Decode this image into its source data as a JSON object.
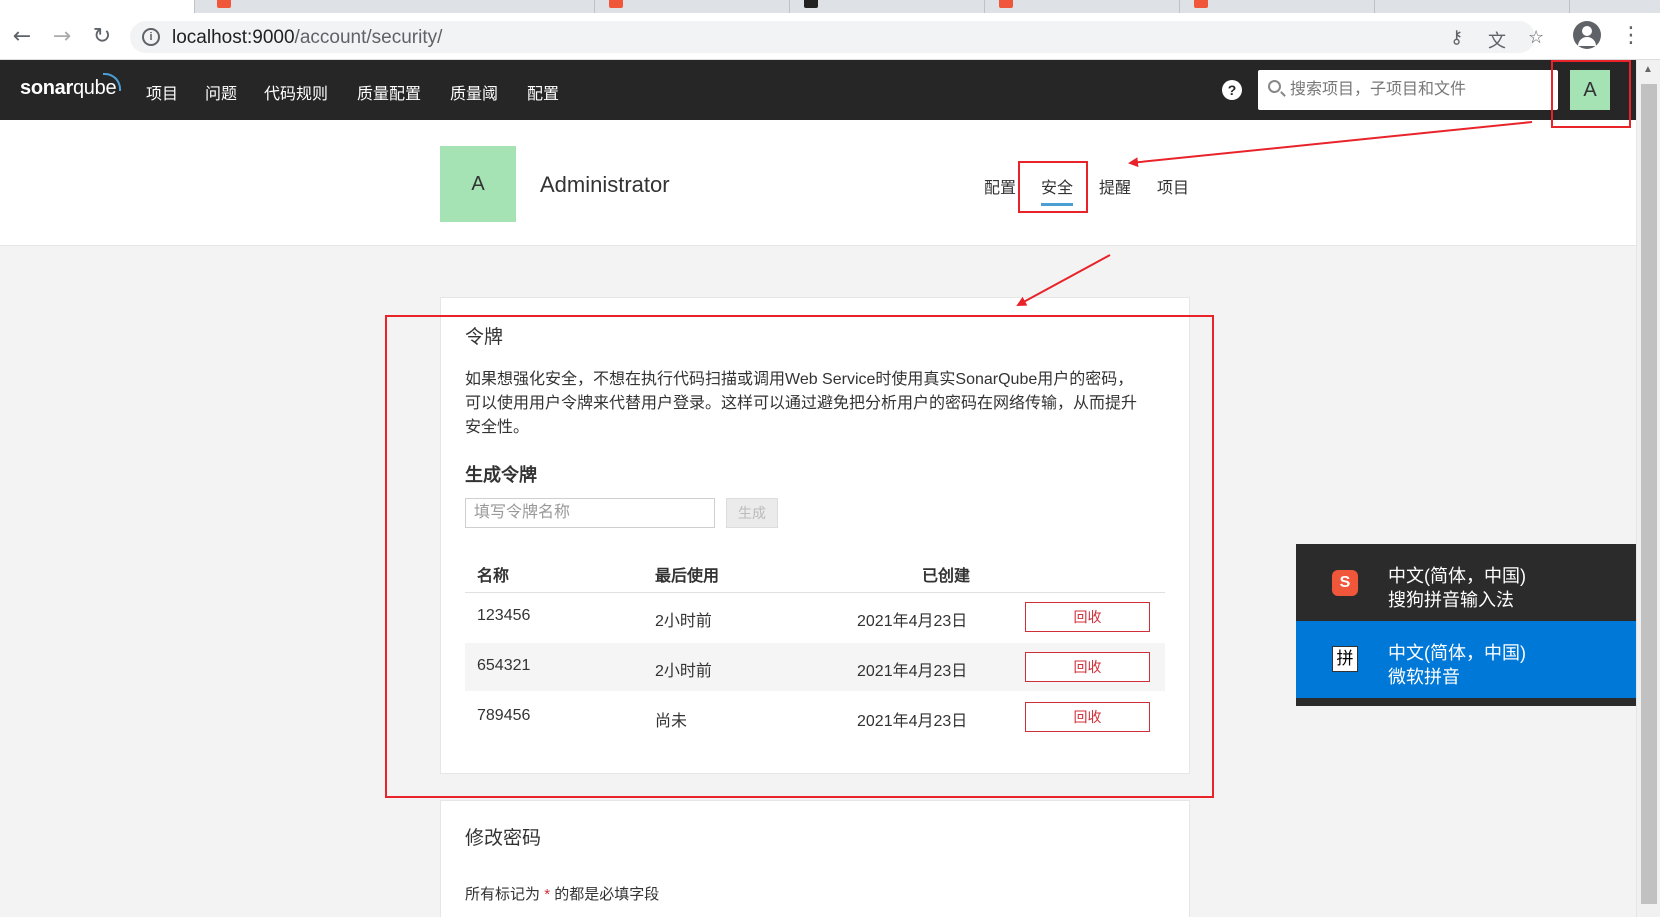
{
  "browser": {
    "url_host": "localhost:9000",
    "url_path": "/account/security/",
    "key_icon": "key-icon",
    "translate_icon": "translate-icon",
    "star_icon": "star-icon"
  },
  "nav": {
    "logo_sonar": "sonar",
    "logo_qube": "qube",
    "items": [
      "项目",
      "问题",
      "代码规则",
      "质量配置",
      "质量阈",
      "配置"
    ],
    "help": "?",
    "search_placeholder": "搜索项目，子项目和文件",
    "avatar_letter": "A"
  },
  "account": {
    "avatar_letter": "A",
    "name": "Administrator",
    "tabs": [
      "配置",
      "安全",
      "提醒",
      "项目"
    ],
    "active_tab": "安全"
  },
  "tokens": {
    "title": "令牌",
    "description": "如果想强化安全，不想在执行代码扫描或调用Web Service时使用真实SonarQube用户的密码，可以使用用户令牌来代替用户登录。这样可以通过避免把分析用户的密码在网络传输，从而提升安全性。",
    "generate_title": "生成令牌",
    "input_placeholder": "填写令牌名称",
    "generate_button": "生成",
    "columns": {
      "name": "名称",
      "last_used": "最后使用",
      "created": "已创建"
    },
    "rows": [
      {
        "name": "123456",
        "last_used": "2小时前",
        "created": "2021年4月23日",
        "action": "回收"
      },
      {
        "name": "654321",
        "last_used": "2小时前",
        "created": "2021年4月23日",
        "action": "回收"
      },
      {
        "name": "789456",
        "last_used": "尚未",
        "created": "2021年4月23日",
        "action": "回收"
      }
    ]
  },
  "password": {
    "title": "修改密码",
    "note_before": "所有标记为",
    "note_star": "*",
    "note_after": "的都是必填字段"
  },
  "ime": {
    "items": [
      {
        "line1": "中文(简体，中国)",
        "line2": "搜狗拼音输入法",
        "icon": "S"
      },
      {
        "line1": "中文(简体，中国)",
        "line2": "微软拼音",
        "icon": "拼"
      }
    ]
  },
  "colors": {
    "nav_bg": "#262626",
    "avatar_green": "#a5e3b5",
    "accent_blue": "#4b9fd5",
    "revoke_red": "#d02f3a",
    "annotation_red": "#e8232a",
    "ime_selected": "#0078d7"
  }
}
